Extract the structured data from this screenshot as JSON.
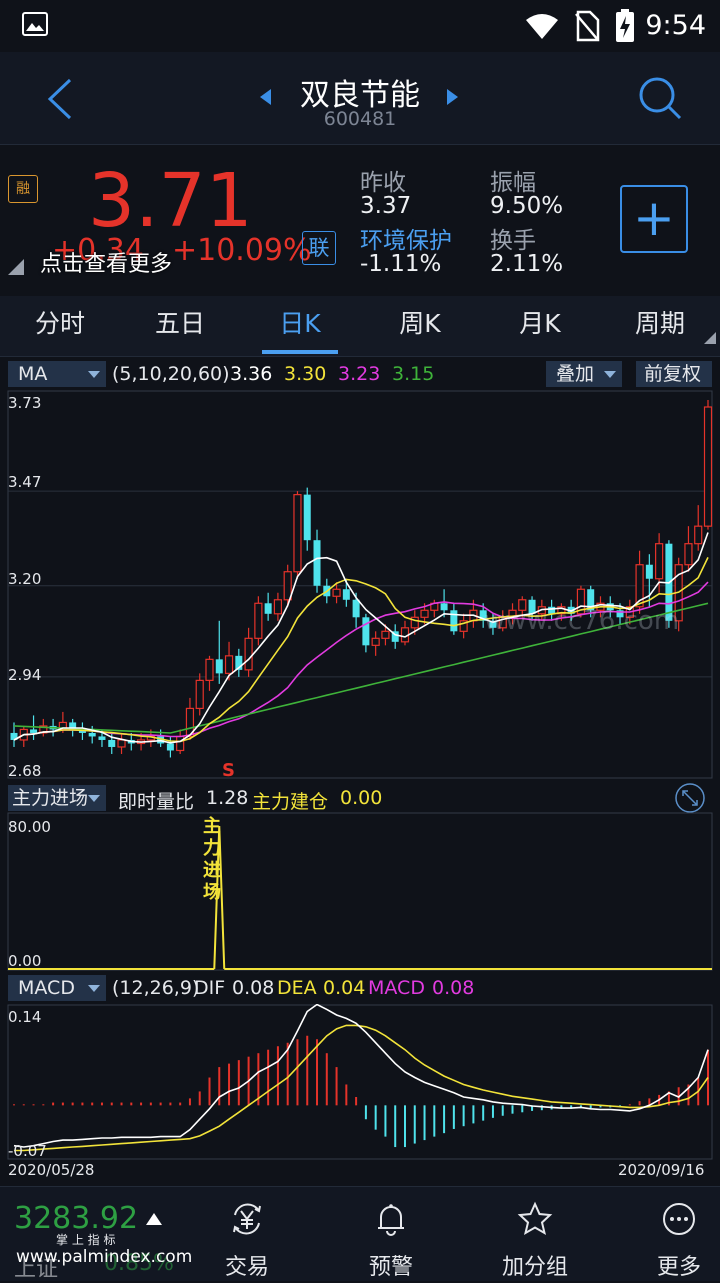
{
  "status_bar": {
    "time": "9:54"
  },
  "header": {
    "title": "双良节能",
    "code": "600481"
  },
  "quote": {
    "margin_badge": "融",
    "price": "3.71",
    "change": "+0.34",
    "change_pct": "+10.09%",
    "more_link": "点击查看更多",
    "lian_badge": "联",
    "prev_close_label": "昨收",
    "prev_close": "3.37",
    "amplitude_label": "振幅",
    "amplitude": "9.50%",
    "sector": "环境保护",
    "sector_change": "-1.11%",
    "turnover_label": "换手",
    "turnover": "2.11%",
    "add_symbol": "+"
  },
  "tabs": [
    {
      "label": "分时"
    },
    {
      "label": "五日"
    },
    {
      "label": "日K",
      "active": true
    },
    {
      "label": "周K"
    },
    {
      "label": "月K"
    },
    {
      "label": "周期"
    }
  ],
  "ma_bar": {
    "indicator": "MA",
    "params": "(5,10,20,60)",
    "v1": "3.36",
    "v2": "3.30",
    "v3": "3.23",
    "v4": "3.15",
    "overlay": "叠加",
    "adjust": "前复权"
  },
  "kline_axis": {
    "y_labels": [
      "3.73",
      "3.47",
      "3.20",
      "2.94",
      "2.68"
    ],
    "signal": "S",
    "watermark": "www.cc76.com"
  },
  "flow_bar": {
    "indicator": "主力进场",
    "ratio_label": "即时量比",
    "ratio": "1.28",
    "build_label": "主力建仓",
    "build": "0.00"
  },
  "flow_axis": {
    "top": "80.00",
    "bottom": "0.00",
    "marker": [
      "主",
      "力",
      "进",
      "场"
    ]
  },
  "macd_bar": {
    "indicator": "MACD",
    "params": "(12,26,9)",
    "dif_label": "DIF",
    "dif": "0.08",
    "dea_label": "DEA",
    "dea": "0.04",
    "macd_label": "MACD",
    "macd": "0.08"
  },
  "macd_axis": {
    "top": "0.14",
    "bottom": "-0.07",
    "date_start": "2020/05/28",
    "date_end": "2020/09/16"
  },
  "bottom_nav": {
    "index_value": "3283.92",
    "index_name": "上证",
    "index_change": "0.85%",
    "watermark_small": "掌 上 指 标",
    "watermark_url": "www.palmindex.com",
    "items": [
      {
        "label": "交易"
      },
      {
        "label": "预警"
      },
      {
        "label": "加分组"
      },
      {
        "label": "更多"
      }
    ]
  },
  "colors": {
    "up": "#e5332a",
    "down": "#4fe3ec",
    "accent": "#4b9ff0",
    "ma5": "#ffffff",
    "ma10": "#f2e33a",
    "ma20": "#e23be0",
    "ma60": "#3fb33a"
  },
  "chart_data": [
    {
      "type": "candlestick",
      "ylim": [
        2.68,
        3.73
      ],
      "y_ticks": [
        "3.73",
        "3.47",
        "3.20",
        "2.94",
        "2.68"
      ],
      "ma_current": {
        "MA5": 3.36,
        "MA10": 3.3,
        "MA20": 3.23,
        "MA60": 3.15
      },
      "candles": [
        [
          2.78,
          2.76,
          2.81,
          2.74
        ],
        [
          2.76,
          2.79,
          2.8,
          2.74
        ],
        [
          2.79,
          2.78,
          2.83,
          2.76
        ],
        [
          2.78,
          2.8,
          2.82,
          2.77
        ],
        [
          2.8,
          2.79,
          2.82,
          2.77
        ],
        [
          2.79,
          2.81,
          2.84,
          2.78
        ],
        [
          2.81,
          2.79,
          2.82,
          2.77
        ],
        [
          2.79,
          2.78,
          2.81,
          2.76
        ],
        [
          2.78,
          2.77,
          2.8,
          2.75
        ],
        [
          2.77,
          2.76,
          2.79,
          2.74
        ],
        [
          2.76,
          2.74,
          2.78,
          2.72
        ],
        [
          2.74,
          2.76,
          2.78,
          2.72
        ],
        [
          2.76,
          2.75,
          2.78,
          2.73
        ],
        [
          2.75,
          2.76,
          2.78,
          2.73
        ],
        [
          2.76,
          2.77,
          2.79,
          2.74
        ],
        [
          2.77,
          2.75,
          2.79,
          2.74
        ],
        [
          2.75,
          2.73,
          2.77,
          2.71
        ],
        [
          2.73,
          2.77,
          2.79,
          2.72
        ],
        [
          2.77,
          2.85,
          2.88,
          2.76
        ],
        [
          2.85,
          2.93,
          2.95,
          2.83
        ],
        [
          2.93,
          2.99,
          3.0,
          2.9
        ],
        [
          2.99,
          2.95,
          3.1,
          2.92
        ],
        [
          2.95,
          3.0,
          3.04,
          2.93
        ],
        [
          3.0,
          2.96,
          3.02,
          2.94
        ],
        [
          2.96,
          3.05,
          3.08,
          2.94
        ],
        [
          3.05,
          3.15,
          3.17,
          3.03
        ],
        [
          3.15,
          3.12,
          3.18,
          3.1
        ],
        [
          3.12,
          3.16,
          3.18,
          3.1
        ],
        [
          3.16,
          3.24,
          3.26,
          3.14
        ],
        [
          3.24,
          3.46,
          3.47,
          3.22
        ],
        [
          3.46,
          3.33,
          3.48,
          3.3
        ],
        [
          3.33,
          3.2,
          3.36,
          3.18
        ],
        [
          3.2,
          3.17,
          3.22,
          3.15
        ],
        [
          3.17,
          3.19,
          3.21,
          3.15
        ],
        [
          3.19,
          3.16,
          3.22,
          3.14
        ],
        [
          3.16,
          3.11,
          3.18,
          3.08
        ],
        [
          3.11,
          3.03,
          3.12,
          3.01
        ],
        [
          3.03,
          3.05,
          3.07,
          3.0
        ],
        [
          3.05,
          3.07,
          3.09,
          3.03
        ],
        [
          3.07,
          3.04,
          3.09,
          3.02
        ],
        [
          3.04,
          3.08,
          3.1,
          3.03
        ],
        [
          3.08,
          3.11,
          3.13,
          3.06
        ],
        [
          3.11,
          3.13,
          3.15,
          3.09
        ],
        [
          3.13,
          3.15,
          3.16,
          3.11
        ],
        [
          3.15,
          3.13,
          3.19,
          3.11
        ],
        [
          3.13,
          3.07,
          3.15,
          3.06
        ],
        [
          3.07,
          3.1,
          3.12,
          3.05
        ],
        [
          3.1,
          3.13,
          3.16,
          3.08
        ],
        [
          3.13,
          3.1,
          3.15,
          3.08
        ],
        [
          3.1,
          3.08,
          3.12,
          3.06
        ],
        [
          3.08,
          3.11,
          3.13,
          3.07
        ],
        [
          3.11,
          3.13,
          3.15,
          3.09
        ],
        [
          3.13,
          3.16,
          3.17,
          3.11
        ],
        [
          3.16,
          3.12,
          3.17,
          3.1
        ],
        [
          3.12,
          3.14,
          3.16,
          3.1
        ],
        [
          3.14,
          3.12,
          3.16,
          3.1
        ],
        [
          3.12,
          3.14,
          3.15,
          3.1
        ],
        [
          3.14,
          3.12,
          3.16,
          3.1
        ],
        [
          3.12,
          3.19,
          3.2,
          3.11
        ],
        [
          3.19,
          3.13,
          3.2,
          3.11
        ],
        [
          3.13,
          3.15,
          3.17,
          3.11
        ],
        [
          3.15,
          3.13,
          3.17,
          3.11
        ],
        [
          3.13,
          3.11,
          3.15,
          3.09
        ],
        [
          3.11,
          3.14,
          3.16,
          3.09
        ],
        [
          3.14,
          3.26,
          3.3,
          3.12
        ],
        [
          3.26,
          3.22,
          3.29,
          3.14
        ],
        [
          3.22,
          3.32,
          3.35,
          3.18
        ],
        [
          3.32,
          3.1,
          3.33,
          3.08
        ],
        [
          3.1,
          3.26,
          3.28,
          3.07
        ],
        [
          3.26,
          3.32,
          3.37,
          3.24
        ],
        [
          3.32,
          3.37,
          3.43,
          3.3
        ],
        [
          3.37,
          3.71,
          3.73,
          3.36
        ]
      ],
      "signal_label": "S",
      "signal_index": 21
    },
    {
      "type": "bar",
      "series": [
        {
          "name": "主力进场",
          "values": [
            80
          ]
        }
      ],
      "ylim": [
        0,
        80
      ],
      "peak_index": 21
    },
    {
      "type": "line",
      "series": [
        {
          "name": "DIF",
          "values": [
            -0.058,
            -0.06,
            -0.058,
            -0.055,
            -0.052,
            -0.05,
            -0.05,
            -0.049,
            -0.048,
            -0.047,
            -0.047,
            -0.046,
            -0.046,
            -0.046,
            -0.046,
            -0.045,
            -0.045,
            -0.045,
            -0.035,
            -0.02,
            -0.005,
            0.012,
            0.02,
            0.025,
            0.035,
            0.048,
            0.055,
            0.063,
            0.08,
            0.107,
            0.135,
            0.145,
            0.138,
            0.13,
            0.125,
            0.118,
            0.105,
            0.09,
            0.075,
            0.06,
            0.048,
            0.04,
            0.033,
            0.028,
            0.023,
            0.018,
            0.012,
            0.01,
            0.008,
            0.005,
            0.003,
            0.002,
            0.001,
            -0.001,
            -0.002,
            -0.003,
            -0.004,
            -0.004,
            -0.003,
            -0.005,
            -0.006,
            -0.006,
            -0.007,
            -0.008,
            -0.005,
            0.0,
            0.008,
            0.018,
            0.012,
            0.025,
            0.04,
            0.08
          ]
        },
        {
          "name": "DEA",
          "values": [
            -0.065,
            -0.065,
            -0.064,
            -0.063,
            -0.062,
            -0.061,
            -0.06,
            -0.059,
            -0.058,
            -0.057,
            -0.056,
            -0.055,
            -0.054,
            -0.053,
            -0.052,
            -0.051,
            -0.05,
            -0.049,
            -0.048,
            -0.044,
            -0.037,
            -0.03,
            -0.02,
            -0.01,
            0.0,
            0.01,
            0.02,
            0.03,
            0.04,
            0.055,
            0.07,
            0.085,
            0.1,
            0.11,
            0.115,
            0.115,
            0.113,
            0.108,
            0.1,
            0.09,
            0.08,
            0.068,
            0.058,
            0.05,
            0.042,
            0.036,
            0.03,
            0.026,
            0.022,
            0.019,
            0.016,
            0.013,
            0.011,
            0.009,
            0.007,
            0.005,
            0.004,
            0.003,
            0.002,
            0.001,
            0.0,
            -0.001,
            -0.002,
            -0.003,
            -0.003,
            -0.002,
            0.0,
            0.004,
            0.006,
            0.01,
            0.02,
            0.04
          ]
        },
        {
          "name": "MACD",
          "values": [
            0.0,
            0.0,
            0.0,
            0.0,
            0.004,
            0.004,
            0.004,
            0.004,
            0.004,
            0.004,
            0.004,
            0.004,
            0.004,
            0.004,
            0.004,
            0.004,
            0.004,
            0.004,
            0.01,
            0.02,
            0.04,
            0.055,
            0.06,
            0.065,
            0.07,
            0.075,
            0.08,
            0.085,
            0.09,
            0.095,
            0.1,
            0.095,
            0.075,
            0.055,
            0.03,
            0.012,
            -0.02,
            -0.035,
            -0.045,
            -0.06,
            -0.06,
            -0.055,
            -0.05,
            -0.045,
            -0.04,
            -0.034,
            -0.03,
            -0.026,
            -0.022,
            -0.018,
            -0.015,
            -0.012,
            -0.01,
            -0.008,
            -0.007,
            -0.006,
            -0.005,
            -0.005,
            -0.004,
            -0.004,
            -0.003,
            -0.003,
            -0.002,
            0.0,
            0.006,
            0.01,
            0.015,
            0.02,
            0.026,
            0.03,
            0.04,
            0.08
          ]
        }
      ],
      "ylim": [
        -0.07,
        0.14
      ],
      "x_labels": [
        "2020/05/28",
        "2020/09/16"
      ]
    }
  ]
}
